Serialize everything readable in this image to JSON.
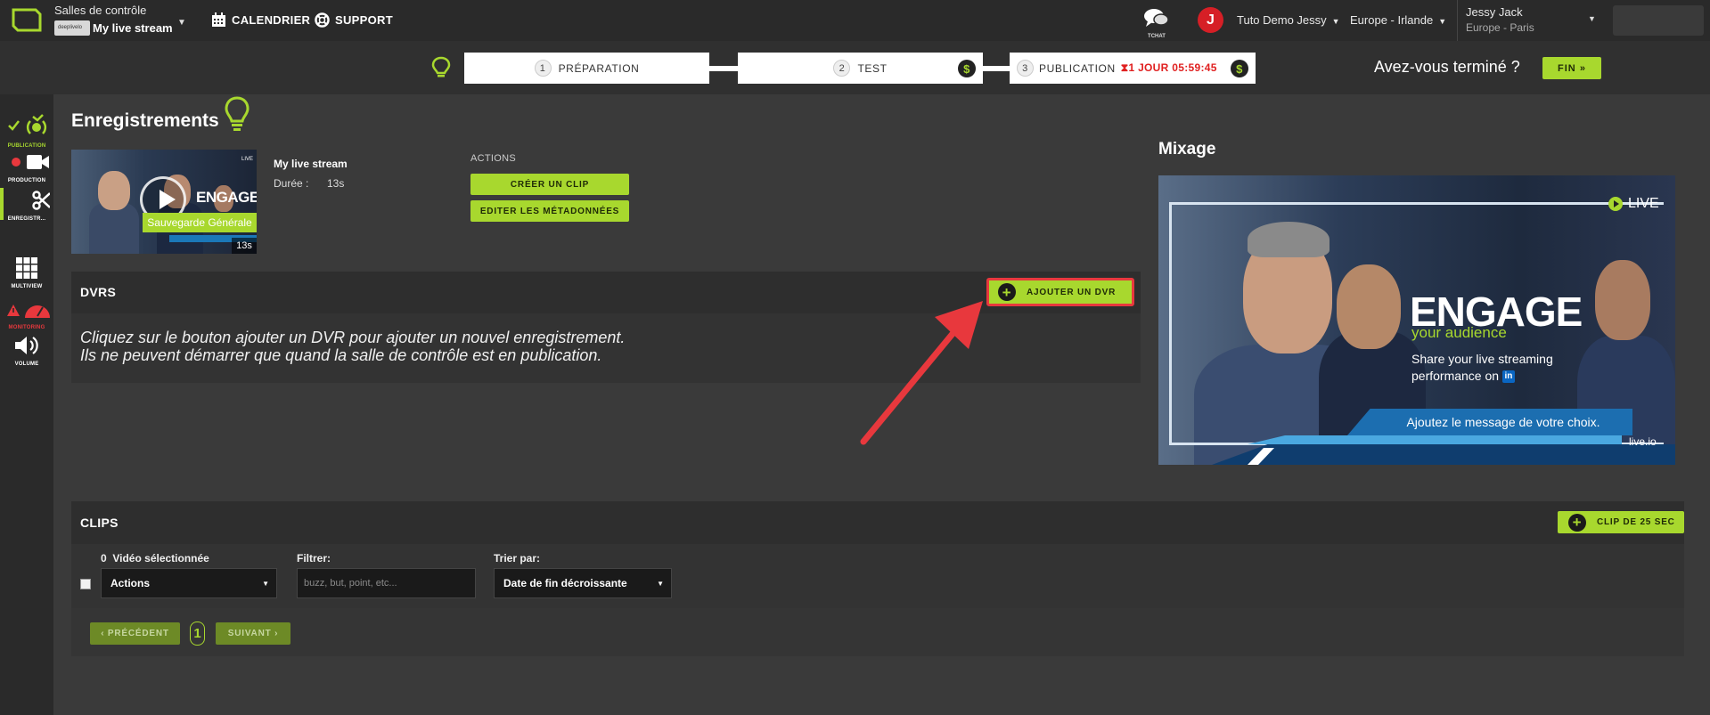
{
  "header": {
    "room_label": "Salles de contrôle",
    "room_thumb": "deeplivelo",
    "room_name": "My live stream",
    "calendar": "CALENDRIER",
    "support": "SUPPORT",
    "tchat": "TCHAT",
    "avatar_initial": "J",
    "account": "Tuto Demo Jessy",
    "region": "Europe - Irlande",
    "user_name": "Jessy Jack",
    "user_tz": "Europe - Paris"
  },
  "steps": [
    {
      "num": "1",
      "label": "PRÉPARATION"
    },
    {
      "num": "2",
      "label": "TEST",
      "coin": "$"
    },
    {
      "num": "3",
      "label": "PUBLICATION",
      "timer": "1 JOUR 05:59:45",
      "coin": "$"
    }
  ],
  "finish": {
    "question": "Avez-vous terminé ?",
    "button": "FIN"
  },
  "sidebar": [
    {
      "label": "PUBLICATION",
      "color": "#a8d82e"
    },
    {
      "label": "PRODUCTION",
      "color": "#ffffff"
    },
    {
      "label": "ENREGISTR...",
      "color": "#ffffff"
    },
    {
      "label": "MULTIVIEW",
      "color": "#ffffff"
    },
    {
      "label": "MONITORING",
      "color": "#e8383d"
    },
    {
      "label": "VOLUME",
      "color": "#ffffff"
    }
  ],
  "recordings": {
    "title": "Enregistrements",
    "item": {
      "title": "My live stream",
      "duration_label": "Durée :",
      "duration": "13s",
      "badge": "Sauvegarde Générale",
      "thumb_duration": "13s",
      "thumb_text": "ENGAGE",
      "thumb_live": "LIVE"
    },
    "actions_label": "ACTIONS",
    "create_clip": "CRÉER UN CLIP",
    "edit_meta": "EDITER LES MÉTADONNÉES"
  },
  "dvrs": {
    "title": "DVRS",
    "add_button": "AJOUTER UN DVR",
    "message_line1": "Cliquez sur le bouton ajouter un DVR pour ajouter un nouvel enregistrement.",
    "message_line2": "Ils ne peuvent démarrer que quand la salle de contrôle est en publication."
  },
  "mixage": {
    "title": "Mixage",
    "live": "LIVE",
    "engage": "ENGAGE",
    "audience": "your audience",
    "share_line1": "Share your live streaming",
    "share_line2": "performance on",
    "linkedin": "in",
    "banner": "Ajoutez le message de votre choix.",
    "brand": "live.io"
  },
  "clips": {
    "title": "CLIPS",
    "clip_button": "CLIP DE 25 SEC",
    "selected_count": "0",
    "selected_label": "Vidéo sélectionnée",
    "actions_select": "Actions",
    "filter_label": "Filtrer:",
    "filter_placeholder": "buzz, but, point, etc...",
    "sort_label": "Trier par:",
    "sort_value": "Date de fin décroissante",
    "prev": "PRÉCÉDENT",
    "page": "1",
    "next": "SUIVANT"
  }
}
